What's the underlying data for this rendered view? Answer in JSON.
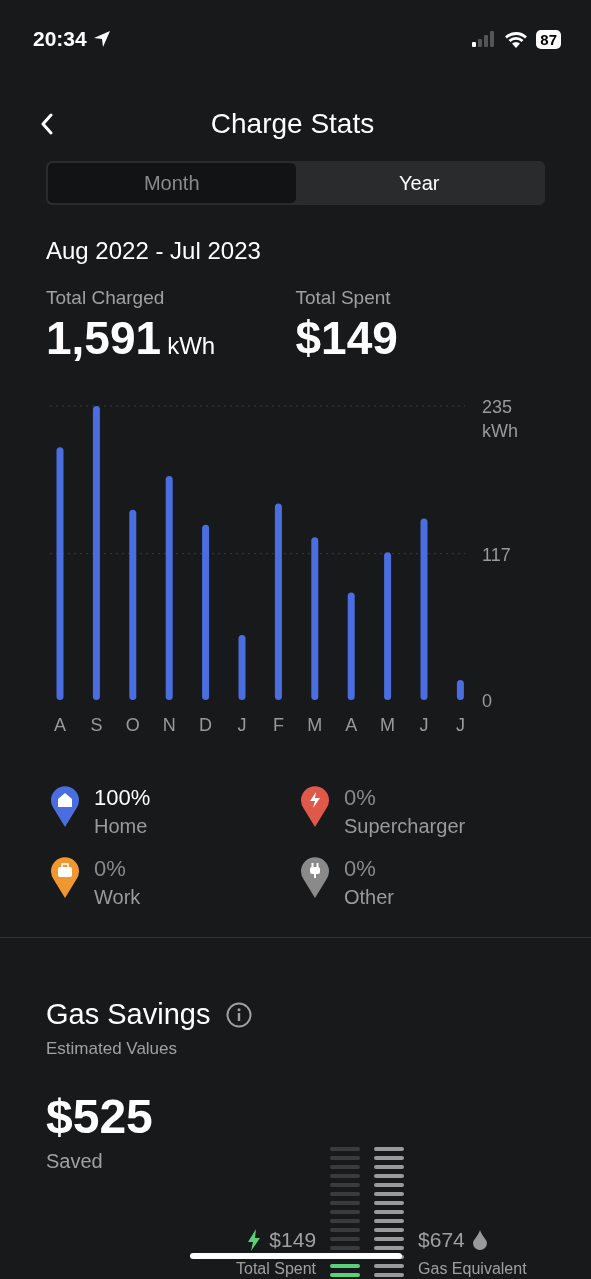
{
  "status_bar": {
    "time": "20:34",
    "battery": "87"
  },
  "header": {
    "title": "Charge Stats"
  },
  "tabs": [
    {
      "label": "Month",
      "selected": false
    },
    {
      "label": "Year",
      "selected": true
    }
  ],
  "period": "Aug 2022 - Jul 2023",
  "totals": [
    {
      "label": "Total Charged",
      "value": "1,591",
      "unit": "kWh"
    },
    {
      "label": "Total Spent",
      "value": "$149"
    }
  ],
  "chart_data": {
    "type": "bar",
    "ylabel": "kWh",
    "categories": [
      "A",
      "S",
      "O",
      "N",
      "D",
      "J",
      "F",
      "M",
      "A",
      "M",
      "J",
      "J"
    ],
    "series": [
      {
        "color": "#4a6ee0",
        "values": [
          202,
          235,
          152,
          179,
          140,
          52,
          157,
          130,
          86,
          118,
          145,
          16
        ]
      }
    ],
    "ylim": [
      0,
      235
    ],
    "yticks": [
      0,
      117,
      {
        "value": 235,
        "label": "235"
      }
    ]
  },
  "locations": [
    {
      "kind": "home",
      "percent": "100%",
      "label": "Home",
      "color": "#4a6ee0",
      "active": true
    },
    {
      "kind": "supercharger",
      "percent": "0%",
      "label": "Supercharger",
      "color": "#e0584a",
      "active": false
    },
    {
      "kind": "work",
      "percent": "0%",
      "label": "Work",
      "color": "#f0982f",
      "active": false
    },
    {
      "kind": "other",
      "percent": "0%",
      "label": "Other",
      "color": "#8a8a8a",
      "active": false
    }
  ],
  "gas_savings": {
    "title": "Gas Savings",
    "subtitle": "Estimated Values",
    "amount": "$525",
    "amount_label": "Saved",
    "spent": {
      "value": "$149",
      "label": "Total Spent",
      "level": 0.2
    },
    "gas": {
      "value": "$674",
      "label": "Gas Equivalent",
      "level": 1
    }
  }
}
